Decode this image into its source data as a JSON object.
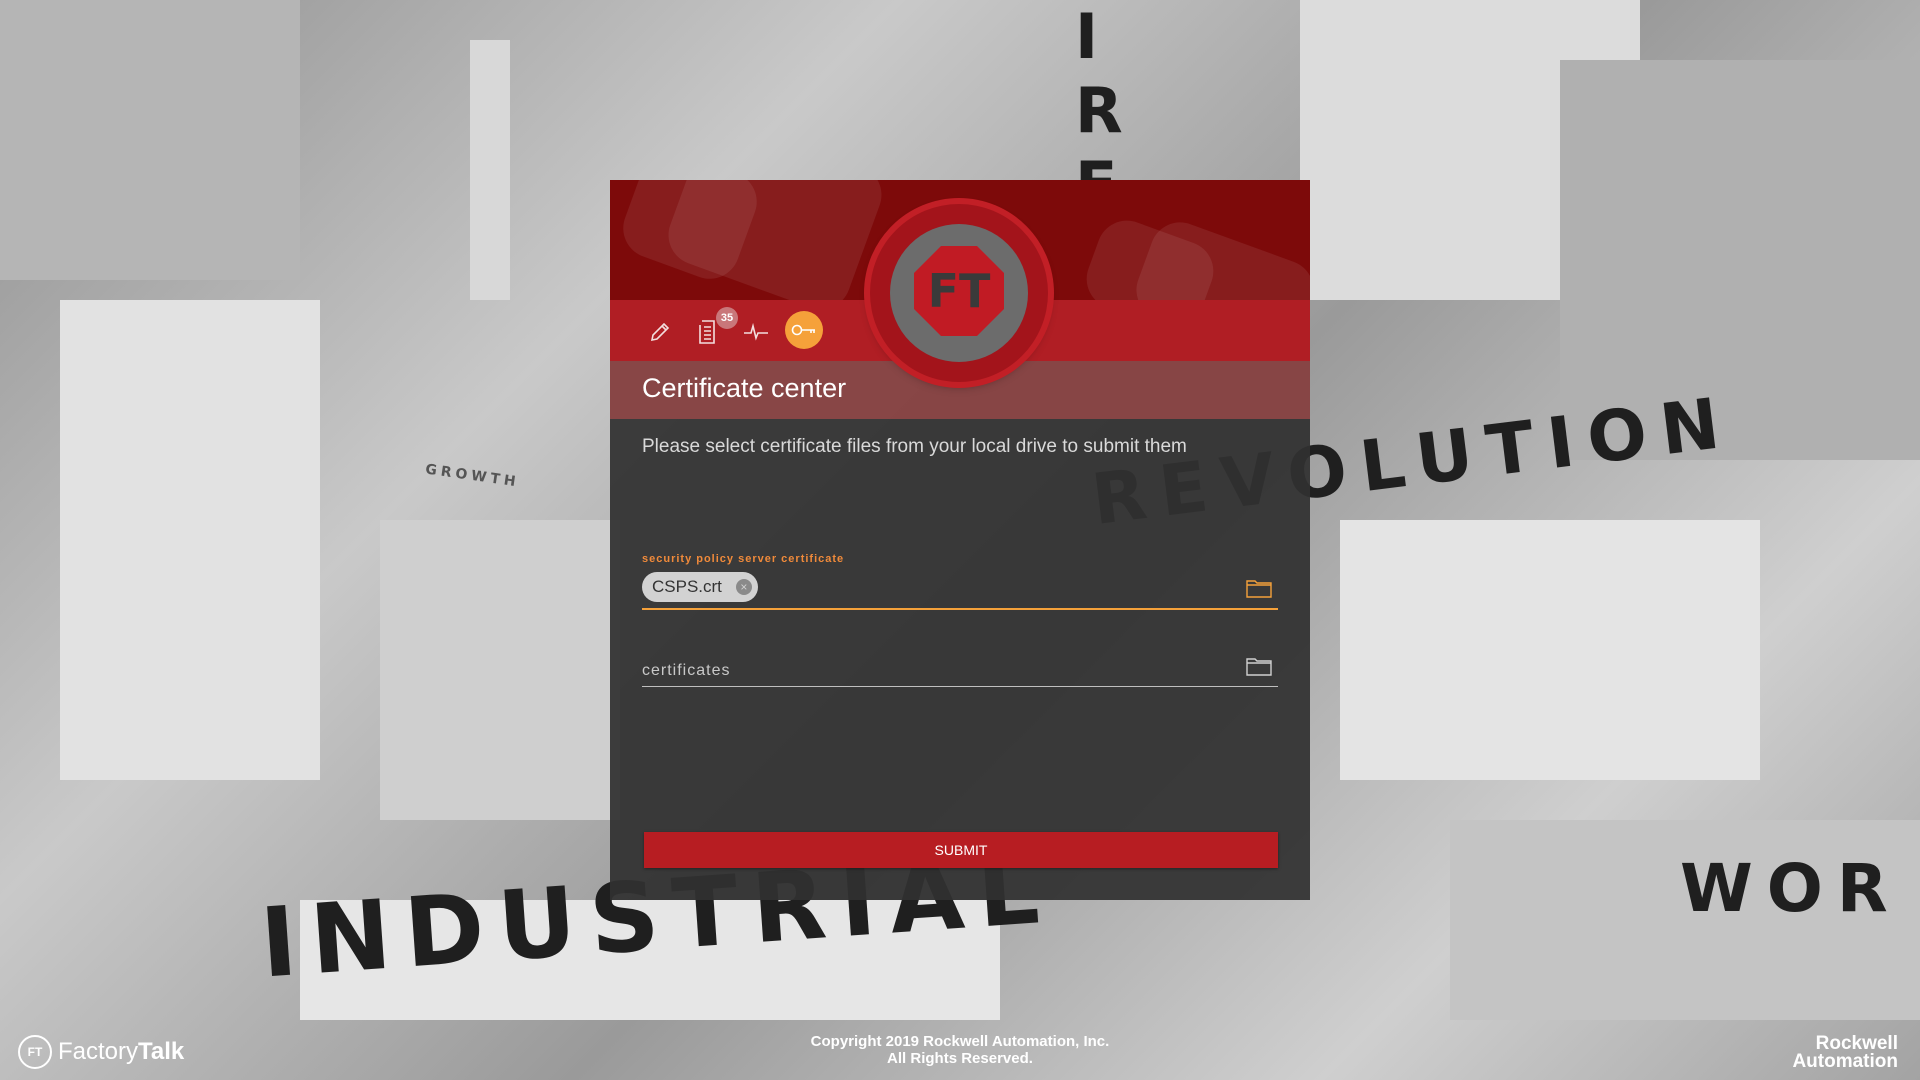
{
  "background": {
    "words": [
      "INDUSTRIAL",
      "REVOLUTION",
      "IRE",
      "WOR",
      "GROWTH"
    ]
  },
  "dialog": {
    "logo_text": "FT",
    "toolbar": {
      "edit_icon": "pencil-icon",
      "logs_icon": "document-list-icon",
      "logs_badge": "35",
      "activity_icon": "pulse-icon",
      "certificates_icon": "key-icon"
    },
    "title": "Certificate center",
    "instruction": "Please select certificate files from your local drive to submit them",
    "security_field": {
      "label": "security  policy server certificate",
      "chip": "CSPS.crt"
    },
    "certificates_field": {
      "placeholder": "certificates"
    },
    "submit_label": "SUBMIT"
  },
  "footer": {
    "brand_light": "Factory",
    "brand_bold": "Talk",
    "brand_mark": "FT",
    "copyright_line1": "Copyright 2019 Rockwell Automation, Inc.",
    "copyright_line2": "All Rights Reserved.",
    "company_line1": "Rockwell",
    "company_line2": "Automation"
  },
  "colors": {
    "primary_red": "#b01e24",
    "accent_orange": "#f5a13a",
    "dialog_bg": "#303030"
  }
}
